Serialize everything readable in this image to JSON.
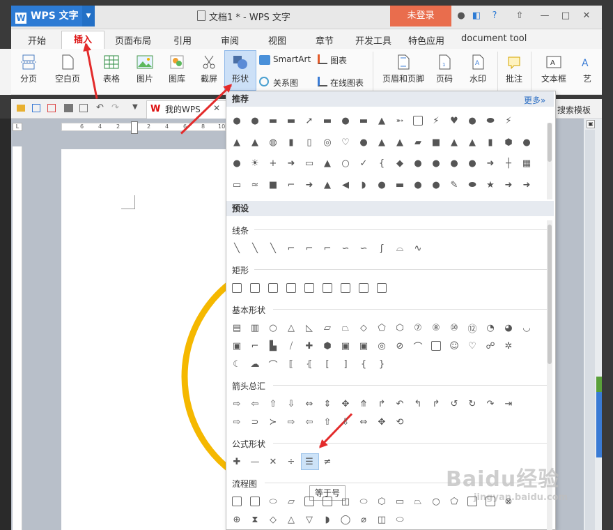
{
  "app": {
    "name": "WPS 文字",
    "doc_title": "文档1 * - WPS 文字",
    "login": "未登录"
  },
  "tabs": [
    "开始",
    "插入",
    "页面布局",
    "引用",
    "审阅",
    "视图",
    "章节",
    "开发工具",
    "特色应用",
    "document tool"
  ],
  "ribbon": {
    "buttons": [
      "分页",
      "空白页",
      "表格",
      "图片",
      "图库",
      "截屏",
      "形状",
      "页眉和页脚",
      "页码",
      "水印",
      "批注",
      "文本框",
      "艺"
    ],
    "small": {
      "smartart": "SmartArt",
      "chart": "图表",
      "relation": "关系图",
      "online_chart": "在线图表"
    }
  },
  "qbar": {
    "mywps": "我的WPS",
    "search_template": "搜索模板"
  },
  "ruler": [
    "6",
    "4",
    "2",
    "2",
    "4",
    "6",
    "8",
    "10"
  ],
  "dropdown": {
    "recommended": "推荐",
    "more": "更多»",
    "preset": "预设",
    "categories": {
      "lines": "线条",
      "rect": "矩形",
      "basic": "基本形状",
      "arrows": "箭头总汇",
      "formula": "公式形状",
      "flow": "流程图"
    },
    "tooltip": "等于号"
  },
  "watermark": {
    "brand": "Baidu经验",
    "url": "jingyan.baidu.com"
  }
}
